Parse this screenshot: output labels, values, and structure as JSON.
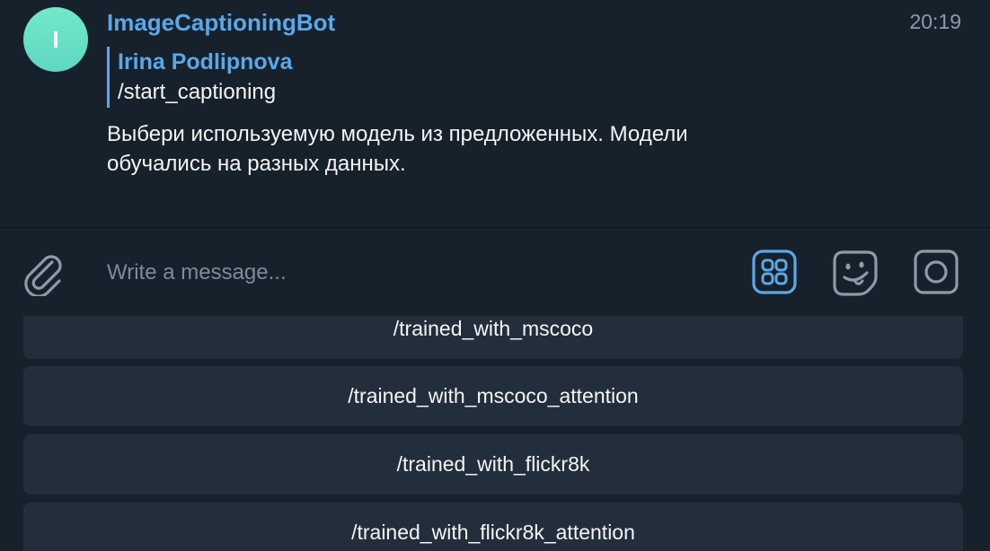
{
  "message": {
    "avatar_letter": "I",
    "sender": "ImageCaptioningBot",
    "time": "20:19",
    "reply": {
      "author": "Irina Podlipnova",
      "text": "/start_captioning"
    },
    "text_line1": "Выбери используемую модель из предложенных. Модели",
    "text_line2": "обучались на разных данных."
  },
  "composer": {
    "placeholder": "Write a message..."
  },
  "icons": {
    "attach": "paperclip-icon",
    "bot_keyboard": "bot-keyboard-icon",
    "sticker": "sticker-emoji-icon",
    "camera": "camera-icon"
  },
  "colors": {
    "background": "#17212b",
    "accent": "#5aa8e8",
    "button_bg": "#232e3c",
    "avatar": "#6fe4c6"
  },
  "keyboard": {
    "buttons": [
      "/trained_with_mscoco",
      "/trained_with_mscoco_attention",
      "/trained_with_flickr8k",
      "/trained_with_flickr8k_attention"
    ]
  }
}
